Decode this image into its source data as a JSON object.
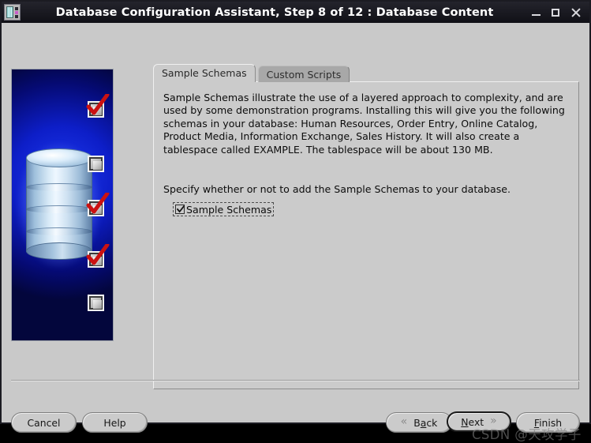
{
  "window": {
    "title": "Database Configuration Assistant, Step 8 of 12 : Database Content",
    "icon": "app-window-icon",
    "controls": {
      "minimize": "–",
      "maximize": "□",
      "close": "✕"
    }
  },
  "banner": {
    "alt": "database-cylinder-illustration",
    "markers": [
      {
        "state": "checked"
      },
      {
        "state": "unchecked"
      },
      {
        "state": "checked"
      },
      {
        "state": "checked"
      },
      {
        "state": "unchecked"
      }
    ]
  },
  "tabs": [
    {
      "label": "Sample Schemas",
      "selected": true
    },
    {
      "label": "Custom Scripts",
      "selected": false
    }
  ],
  "content": {
    "paragraph1": "Sample Schemas illustrate the use of a layered approach to complexity, and are used by some demonstration programs. Installing this will give you the following schemas in your database: Human Resources, Order Entry, Online Catalog, Product Media, Information Exchange, Sales History. It will also create a tablespace called EXAMPLE. The tablespace will be about 130 MB.",
    "paragraph2": "Specify whether or not to add the Sample Schemas to your database.",
    "checkbox": {
      "label": "Sample Schemas",
      "checked": true
    }
  },
  "buttons": {
    "cancel": {
      "label": "Cancel"
    },
    "help": {
      "label": "Help"
    },
    "back": {
      "prefix": "B",
      "mnemonic": "a",
      "suffix": "ck",
      "label": "Back",
      "arrow": "«"
    },
    "next": {
      "prefix": "",
      "mnemonic": "N",
      "suffix": "ext",
      "label": "Next",
      "arrow": "»",
      "default": true
    },
    "finish": {
      "prefix": "",
      "mnemonic": "F",
      "suffix": "inish",
      "label": "Finish"
    }
  },
  "watermark": {
    "text": "CSDN @天攻学子"
  },
  "colors": {
    "titlebar": "#191920",
    "window_bg": "#c9c9c9",
    "panel_bg": "#cbcbcb",
    "tab_selected": "#cbcbcb",
    "tab_unselected": "#a8a8a8",
    "banner_blue": "#0d1ec8",
    "check_red": "#cc1111",
    "text": "#0c0c0c"
  }
}
